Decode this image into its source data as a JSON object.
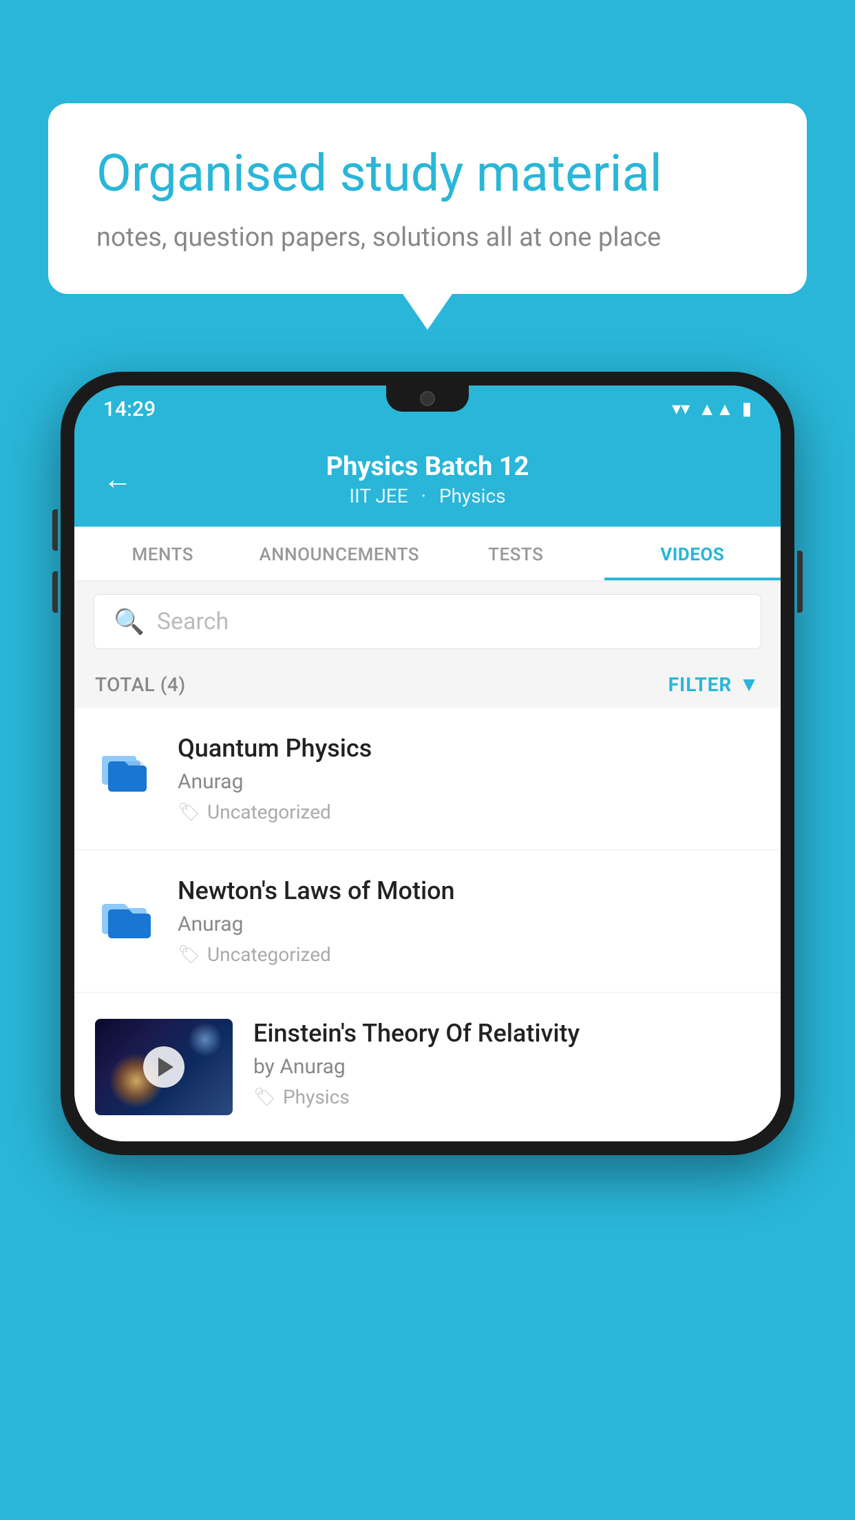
{
  "background_color": "#29B6D8",
  "speech_bubble": {
    "title": "Organised study material",
    "subtitle": "notes, question papers, solutions all at one place"
  },
  "phone": {
    "status_bar": {
      "time": "14:29",
      "icons": [
        "wifi",
        "signal",
        "battery"
      ]
    },
    "header": {
      "back_label": "←",
      "title": "Physics Batch 12",
      "subtitle_part1": "IIT JEE",
      "subtitle_part2": "Physics"
    },
    "tabs": [
      {
        "label": "MENTS",
        "active": false
      },
      {
        "label": "ANNOUNCEMENTS",
        "active": false
      },
      {
        "label": "TESTS",
        "active": false
      },
      {
        "label": "VIDEOS",
        "active": true
      }
    ],
    "search": {
      "placeholder": "Search"
    },
    "total": {
      "label": "TOTAL (4)",
      "filter_label": "FILTER"
    },
    "videos": [
      {
        "title": "Quantum Physics",
        "author": "Anurag",
        "tag": "Uncategorized",
        "has_thumbnail": false
      },
      {
        "title": "Newton's Laws of Motion",
        "author": "Anurag",
        "tag": "Uncategorized",
        "has_thumbnail": false
      },
      {
        "title": "Einstein's Theory Of Relativity",
        "author": "by Anurag",
        "tag": "Physics",
        "has_thumbnail": true
      }
    ]
  }
}
